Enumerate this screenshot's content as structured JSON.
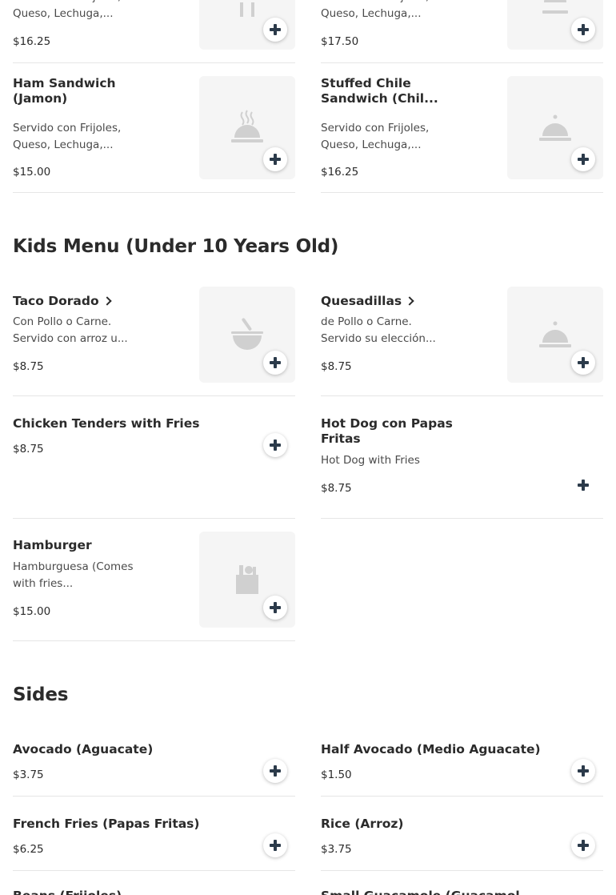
{
  "colors": {
    "text": "#2b2b2b",
    "muted": "#4a4a4a",
    "divider": "#e6e6e6",
    "thumb_bg": "#f5f5f5",
    "icon": "#d0d0d0",
    "button_icon": "#2b3a4a"
  },
  "top_items": [
    {
      "desc": "Servido con Frijoles, Queso, Lechuga,...",
      "price": "$16.25",
      "icon": "fork-knife-icon"
    },
    {
      "desc": "Servido con Frijoles, Queso, Lechuga,...",
      "price": "$17.50",
      "icon": "cloche-icon"
    }
  ],
  "row2": [
    {
      "name": "Ham Sandwich (Jamon)",
      "desc": "Servido con Frijoles, Queso, Lechuga,...",
      "price": "$15.00",
      "icon": "steaming-dish-icon"
    },
    {
      "name": "Stuffed Chile Sandwich (Chil...",
      "desc": "Servido con Frijoles, Queso, Lechuga,...",
      "price": "$16.25",
      "icon": "cloche-icon"
    }
  ],
  "kids_menu": {
    "title": "Kids Menu (Under 10 Years Old)",
    "items": [
      {
        "name": "Taco Dorado",
        "desc": "Con Pollo o Carne. Servido con arroz u...",
        "price": "$8.75",
        "icon": "bowl-icon"
      },
      {
        "name": "Quesadillas",
        "desc": "de Pollo o Carne. Servido su elección...",
        "price": "$8.75",
        "icon": "cloche-icon"
      },
      {
        "name": "Chicken Tenders with Fries",
        "price": "$8.75"
      },
      {
        "name": "Hot Dog con Papas Fritas",
        "desc": "Hot Dog with Fries",
        "price": "$8.75"
      },
      {
        "name": "Hamburger",
        "desc": "Hamburguesa (Comes with fries...",
        "price": "$15.00",
        "icon": "grocery-bag-icon"
      }
    ]
  },
  "sides": {
    "title": "Sides",
    "items": [
      {
        "name": "Avocado (Aguacate)",
        "price": "$3.75"
      },
      {
        "name": "Half Avocado (Medio Aguacate)",
        "price": "$1.50"
      },
      {
        "name": "French Fries (Papas Fritas)",
        "price": "$6.25"
      },
      {
        "name": "Rice (Arroz)",
        "price": "$3.75"
      },
      {
        "name": "Beans (Frijoles)"
      },
      {
        "name": "Small Guacamole (Guacamol..."
      }
    ]
  }
}
